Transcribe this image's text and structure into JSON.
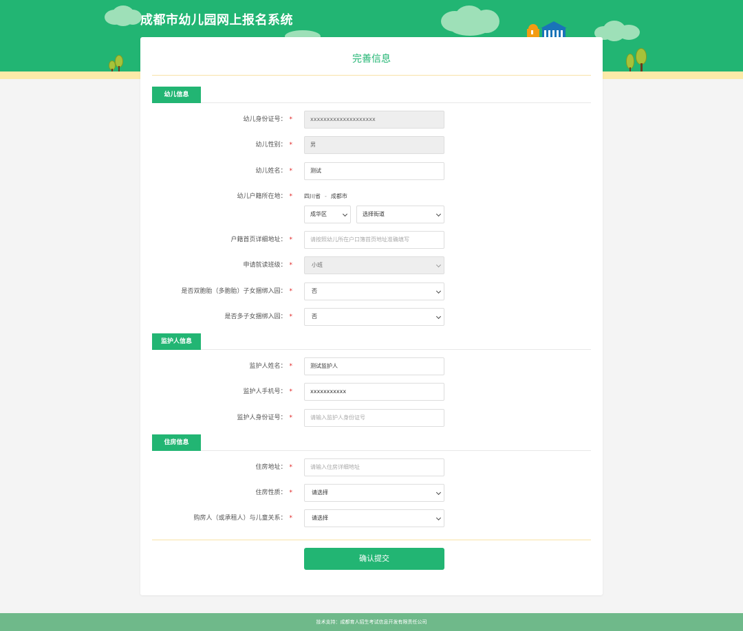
{
  "header": {
    "title": "成都市幼儿园网上报名系统"
  },
  "form": {
    "title": "完善信息",
    "sections": {
      "child": "幼儿信息",
      "guardian": "监护人信息",
      "housing": "住房信息"
    },
    "child": {
      "id_label": "幼儿身份证号：",
      "id_value": "xxxxxxxxxxxxxxxxxxxx",
      "gender_label": "幼儿性别：",
      "gender_value": "男",
      "name_label": "幼儿姓名：",
      "name_value": "测试",
      "hukou_label": "幼儿户籍所在地：",
      "hukou_province": "四川省",
      "hukou_separator": "-",
      "hukou_city": "成都市",
      "district_value": "成华区",
      "street_value": "选择街道",
      "address_label": "户籍首页详细地址：",
      "address_placeholder": "请按照幼儿所在户口簿首页地址准确填写",
      "class_label": "申请就读班级：",
      "class_value": "小班",
      "twins_label": "是否双胞胎（多胞胎）子女捆绑入园：",
      "twins_value": "否",
      "multi_label": "是否多子女捆绑入园：",
      "multi_value": "否"
    },
    "guardian": {
      "name_label": "监护人姓名：",
      "name_value": "测试监护人",
      "phone_label": "监护人手机号：",
      "phone_value": "xxxxxxxxxxx",
      "id_label": "监护人身份证号：",
      "id_placeholder": "请输入监护人身份证号"
    },
    "housing": {
      "address_label": "住房地址：",
      "address_placeholder": "请输入住房详细地址",
      "nature_label": "住房性质：",
      "nature_value": "请选择",
      "relation_label": "购房人（或承租人）与儿童关系：",
      "relation_value": "请选择"
    },
    "required_mark": "*",
    "submit_label": "确认提交"
  },
  "footer": {
    "text": "技术支持：成都育人招生考试信息开发有限责任公司"
  },
  "colors": {
    "brand": "#22b573",
    "ground": "#fbeaa8",
    "footer": "#6fb98a",
    "required": "#e02020"
  }
}
